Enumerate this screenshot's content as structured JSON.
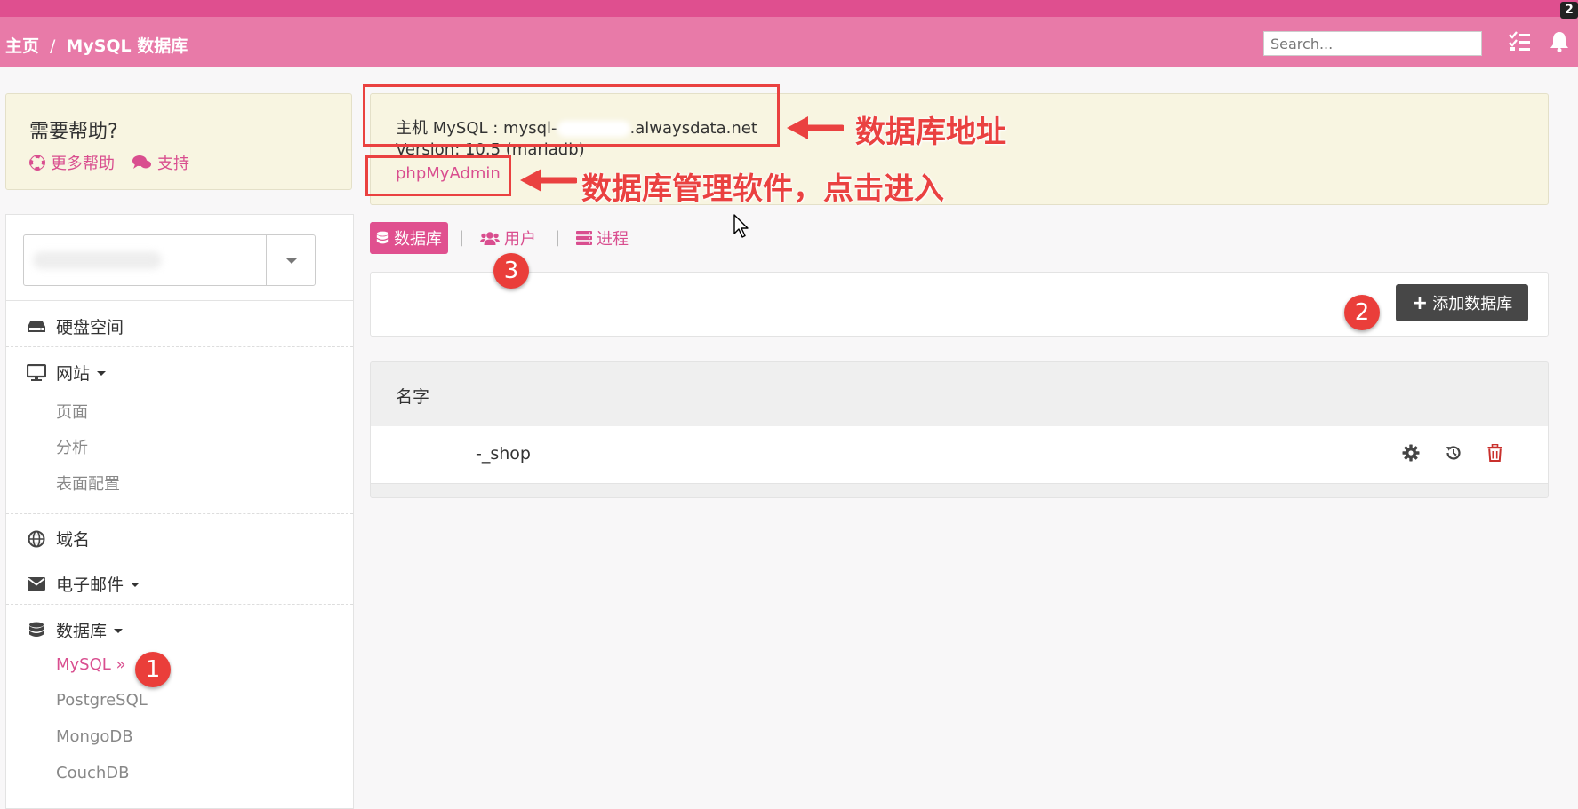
{
  "navbar": {
    "breadcrumb_home": "主页",
    "breadcrumb_sep": "/",
    "breadcrumb_current": "MySQL 数据库",
    "search_placeholder": "Search...",
    "tasks_icon": "tasks-icon",
    "bell_icon": "bell-icon",
    "notification_count": "2"
  },
  "help": {
    "title": "需要帮助?",
    "more_help": "更多帮助",
    "support": "支持",
    "more_help_icon": "lifebuoy-icon",
    "support_icon": "comments-icon"
  },
  "sidebar": {
    "account_select_icon": "caret-down-icon",
    "items": [
      {
        "label": "硬盘空间",
        "icon": "hdd-icon"
      },
      {
        "label": "网站",
        "icon": "desktop-icon",
        "subitems": [
          "页面",
          "分析",
          "表面配置"
        ]
      },
      {
        "label": "域名",
        "icon": "globe-icon"
      },
      {
        "label": "电子邮件",
        "icon": "envelope-icon"
      },
      {
        "label": "数据库",
        "icon": "database-icon",
        "subitems": [
          "MySQL »",
          "PostgreSQL",
          "MongoDB",
          "CouchDB"
        ]
      }
    ]
  },
  "info": {
    "host_prefix": "主机 MySQL : mysql-",
    "host_suffix": ".alwaysdata.net",
    "version": "Version: 10.5 (mariadb)",
    "phpmyadmin": "phpMyAdmin"
  },
  "tabs": [
    {
      "label": "数据库",
      "icon": "database-icon",
      "active": true
    },
    {
      "label": "用户",
      "icon": "users-icon",
      "active": false
    },
    {
      "label": "进程",
      "icon": "server-icon",
      "active": false
    }
  ],
  "tab_separator": "|",
  "add_button": {
    "label": "添加数据库",
    "plus": "+"
  },
  "table": {
    "header": "名字",
    "rows": [
      {
        "name": "-_shop",
        "actions": [
          "gear-icon",
          "history-icon",
          "trash-icon"
        ]
      }
    ]
  },
  "annotations": {
    "address_label": "数据库地址",
    "admin_label": "数据库管理软件，点击进入",
    "marker1": "1",
    "marker2": "2",
    "marker3": "3"
  },
  "colors": {
    "accent": "#d94e8f",
    "navbar": "#e87aa8",
    "topstrip": "#df4f8f",
    "annotation_red": "#ea4140"
  }
}
